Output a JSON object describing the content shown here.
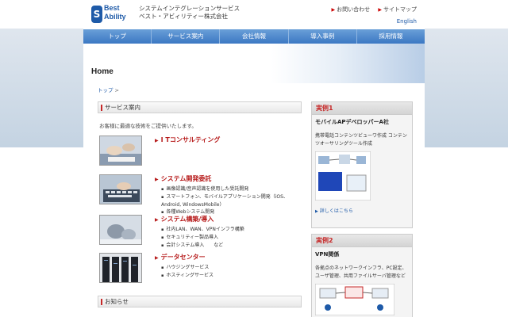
{
  "logo": {
    "mark": "S",
    "line1": "Best",
    "line2": "Ability"
  },
  "company": {
    "line1": "システムインテグレーションサービス",
    "line2": "ベスト・アビィリティー株式会社"
  },
  "util_links": {
    "contact": "お問い合わせ",
    "sitemap": "サイトマップ",
    "english": "English"
  },
  "nav": [
    "トップ",
    "サービス案内",
    "会社情報",
    "導入事例",
    "採用情報"
  ],
  "hero": {
    "title": "Home"
  },
  "breadcrumb": {
    "home": "トップ",
    "sep": ">"
  },
  "services": {
    "heading": "サービス案内",
    "intro": "お客様に最適な技術をご提供いたします。",
    "items": [
      {
        "title": "I Tコンサルティング",
        "bullets": []
      },
      {
        "title": "システム開発委託",
        "bullets": [
          "画像認識/音声認識を使用した受託開発",
          "スマートフォン、モバイルアプリケーション開発（iOS、Android, WindowsMobile）",
          "各種Webシステム開発"
        ]
      },
      {
        "title": "システム構築/導入",
        "bullets": [
          "社内LAN、WAN、VPNインフラ構築",
          "セキュリティー製品導入",
          "会計システム導入　　など"
        ]
      },
      {
        "title": "データセンター",
        "bullets": [
          "ハウジングサービス",
          "ホスティングサービス"
        ]
      }
    ]
  },
  "news": {
    "heading": "お知らせ"
  },
  "cases": [
    {
      "label": "実例1",
      "title": "モバイルAPデベロッパーA社",
      "desc": "携帯電話コンテンツビューワ作成 コンテンツオーサリングツール作成",
      "more": "詳しくはこちら"
    },
    {
      "label": "実例2",
      "title": "VPN関係",
      "desc": "各拠点のネットワークインフラ、PC設定、ユーザ管理、共用ファイルサーバ管理など",
      "more": ""
    }
  ],
  "colors": {
    "accent": "#c62828",
    "nav": "#3b78c3",
    "link": "#1e5aa8"
  }
}
